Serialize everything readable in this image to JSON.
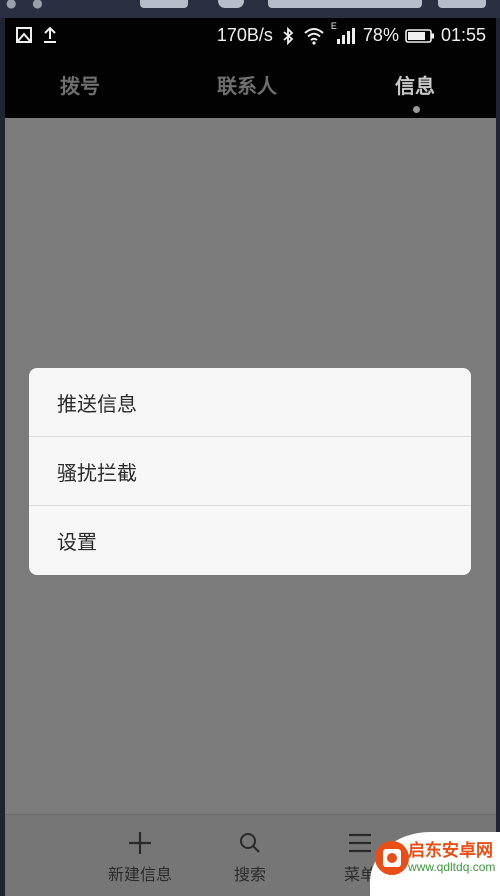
{
  "statusbar": {
    "speed": "170B/s",
    "battery_percent": "78%",
    "time": "01:55",
    "network_type": "E",
    "icons": [
      "image-icon",
      "upload-icon",
      "bluetooth-icon",
      "wifi-icon",
      "signal-icon",
      "battery-icon"
    ]
  },
  "tabs": [
    {
      "label": "拨号",
      "active": false
    },
    {
      "label": "联系人",
      "active": false
    },
    {
      "label": "信息",
      "active": true
    }
  ],
  "popup_menu": {
    "items": [
      {
        "label": "推送信息"
      },
      {
        "label": "骚扰拦截"
      },
      {
        "label": "设置"
      }
    ]
  },
  "bottom_bar": {
    "new_message": {
      "label": "新建信息",
      "icon": "plus-icon"
    },
    "search": {
      "label": "搜索",
      "icon": "search-icon"
    },
    "menu": {
      "label": "菜单",
      "icon": "menu-icon"
    }
  },
  "watermark": {
    "title": "启东安卓网",
    "url": "www.qdltdq.com"
  },
  "colors": {
    "overlay": "#7b7b7b",
    "bar_background": "#020202",
    "menu_background": "#f7f7f7",
    "watermark_red": "#e94e16",
    "watermark_green": "#3a9a3a"
  }
}
